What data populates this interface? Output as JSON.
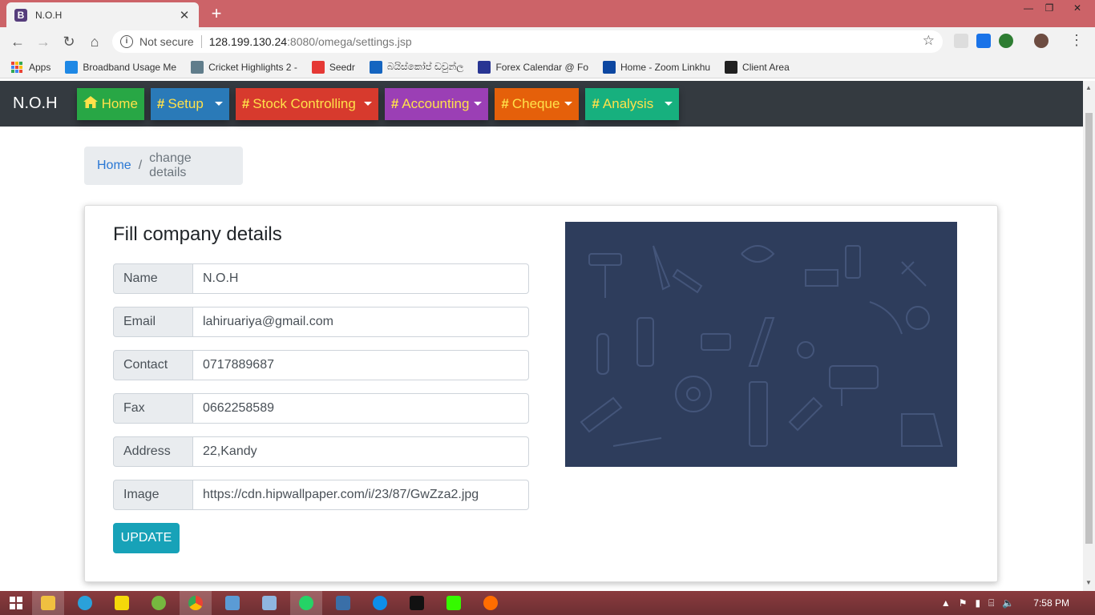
{
  "browser": {
    "tab_title": "N.O.H",
    "tab_favicon": "B",
    "new_tab": "+",
    "security": "Not secure",
    "url_host": "128.199.130.24",
    "url_rest": ":8080/omega/settings.jsp"
  },
  "bookmarks": [
    {
      "label": "Apps",
      "icon": "apps-grid-icon",
      "color": "#4285f4"
    },
    {
      "label": "Broadband Usage Me",
      "icon": "broadband-icon",
      "color": "#1e88e5"
    },
    {
      "label": "Cricket Highlights 2 -",
      "icon": "cricket-icon",
      "color": "#607d8b"
    },
    {
      "label": "Seedr",
      "icon": "seedr-icon",
      "color": "#e53935"
    },
    {
      "label": "බයිස්කෝප් ඩවුන්ල",
      "icon": "bioscope-icon",
      "color": "#1565c0"
    },
    {
      "label": "Forex Calendar @ Fo",
      "icon": "forex-icon",
      "color": "#283593"
    },
    {
      "label": "Home - Zoom Linkhu",
      "icon": "zoom-icon",
      "color": "#0d47a1"
    },
    {
      "label": "Client Area",
      "icon": "client-area-icon",
      "color": "#212121"
    }
  ],
  "navbar": {
    "brand": "N.O.H",
    "items": [
      {
        "label": "Home",
        "icon": "home-icon",
        "color": "#28a745",
        "dropdown": false
      },
      {
        "label": "Setup",
        "icon": "hash-icon",
        "color": "#2a7ab8",
        "dropdown": true
      },
      {
        "label": "Stock Controlling",
        "icon": "hash-icon",
        "color": "#d73a2d",
        "dropdown": true
      },
      {
        "label": "Accounting",
        "icon": "hash-icon",
        "color": "#9b3fb5",
        "dropdown": true
      },
      {
        "label": "Cheque",
        "icon": "hash-icon",
        "color": "#e5600a",
        "dropdown": true
      },
      {
        "label": "Analysis",
        "icon": "hash-icon",
        "color": "#17b07e",
        "dropdown": true
      }
    ]
  },
  "breadcrumb": {
    "home": "Home",
    "separator": "/",
    "current": "change details"
  },
  "form": {
    "title": "Fill company details",
    "fields": [
      {
        "label": "Name",
        "value": "N.O.H"
      },
      {
        "label": "Email",
        "value": "lahiruariya@gmail.com"
      },
      {
        "label": "Contact",
        "value": "0717889687"
      },
      {
        "label": "Fax",
        "value": "0662258589"
      },
      {
        "label": "Address",
        "value": "22,Kandy"
      },
      {
        "label": "Image",
        "value": "https://cdn.hipwallpaper.com/i/23/87/GwZza2.jpg"
      }
    ],
    "submit_label": "UPDATE"
  },
  "taskbar": {
    "time": "7:58 PM"
  }
}
